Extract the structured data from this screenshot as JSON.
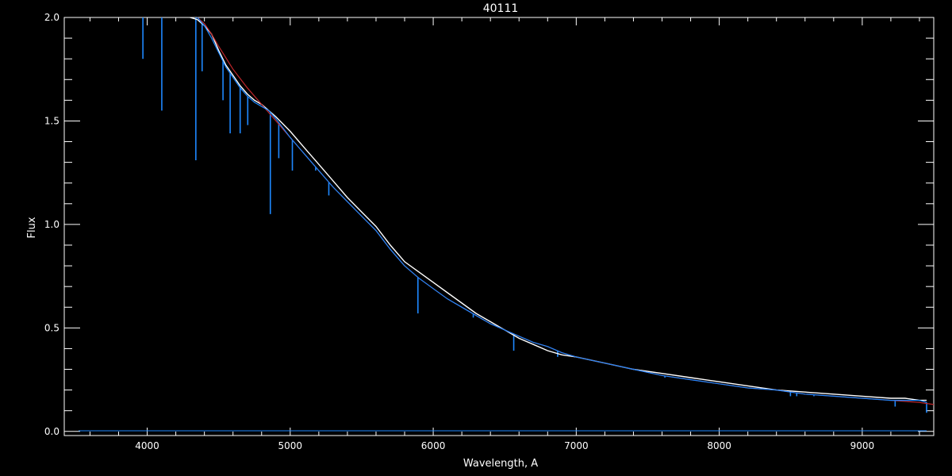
{
  "chart_data": {
    "type": "line",
    "title": "40111",
    "xlabel": "Wavelength, A",
    "ylabel": "Flux",
    "xlim": [
      3420,
      9500
    ],
    "ylim": [
      -0.02,
      2.0
    ],
    "x_ticks": [
      {
        "value": 4000,
        "label": "4000"
      },
      {
        "value": 5000,
        "label": "5000"
      },
      {
        "value": 6000,
        "label": "6000"
      },
      {
        "value": 7000,
        "label": "7000"
      },
      {
        "value": 8000,
        "label": "8000"
      },
      {
        "value": 9000,
        "label": "9000"
      }
    ],
    "y_ticks": [
      {
        "value": 0.0,
        "label": "0.0"
      },
      {
        "value": 0.5,
        "label": "0.5"
      },
      {
        "value": 1.0,
        "label": "1.0"
      },
      {
        "value": 1.5,
        "label": "1.5"
      },
      {
        "value": 2.0,
        "label": "2.0"
      }
    ],
    "grid": false,
    "legend": "none",
    "colors": {
      "background": "#000000",
      "axes": "#ffffff",
      "observed": "#ffffff",
      "model_smooth": "#c0262a",
      "model_detailed": "#1e88ff"
    },
    "series": [
      {
        "color": "#ffffff",
        "x": [
          4300,
          4350,
          4400,
          4450,
          4500,
          4550,
          4600,
          4650,
          4700,
          4750,
          4800,
          4850,
          4900,
          5000,
          5100,
          5200,
          5300,
          5400,
          5500,
          5600,
          5700,
          5800,
          5900,
          6000,
          6100,
          6200,
          6300,
          6400,
          6500,
          6600,
          6700,
          6800,
          6900,
          7000,
          7200,
          7400,
          7600,
          7800,
          8000,
          8200,
          8400,
          8600,
          8800,
          9000,
          9200,
          9300,
          9400,
          9450
        ],
        "y": [
          2.0,
          1.99,
          1.96,
          1.92,
          1.84,
          1.77,
          1.72,
          1.67,
          1.63,
          1.6,
          1.58,
          1.55,
          1.52,
          1.45,
          1.37,
          1.29,
          1.21,
          1.13,
          1.06,
          0.99,
          0.9,
          0.82,
          0.77,
          0.72,
          0.67,
          0.62,
          0.57,
          0.53,
          0.49,
          0.45,
          0.42,
          0.39,
          0.37,
          0.36,
          0.33,
          0.3,
          0.28,
          0.26,
          0.24,
          0.22,
          0.2,
          0.19,
          0.18,
          0.17,
          0.16,
          0.16,
          0.15,
          0.15
        ]
      },
      {
        "color": "#c0262a",
        "x": [
          4350,
          4400,
          4450,
          4500,
          4600,
          4700,
          4800,
          4900,
          5000,
          5100,
          5200,
          5300,
          5400,
          5500,
          5600,
          5700,
          5800,
          5900,
          6000,
          6100,
          6200,
          6300,
          6400,
          6500,
          6600,
          6700,
          6800,
          6900,
          7000,
          7200,
          7400,
          7600,
          7800,
          8000,
          8200,
          8400,
          8600,
          8800,
          9000,
          9200,
          9400,
          9500
        ],
        "y": [
          2.0,
          1.97,
          1.92,
          1.86,
          1.75,
          1.66,
          1.58,
          1.5,
          1.42,
          1.34,
          1.26,
          1.18,
          1.11,
          1.04,
          0.97,
          0.88,
          0.8,
          0.74,
          0.69,
          0.64,
          0.6,
          0.56,
          0.52,
          0.49,
          0.46,
          0.43,
          0.41,
          0.38,
          0.36,
          0.33,
          0.3,
          0.27,
          0.25,
          0.23,
          0.21,
          0.2,
          0.18,
          0.17,
          0.16,
          0.15,
          0.14,
          0.13
        ]
      },
      {
        "color": "#1e88ff",
        "x": [
          4350,
          4400,
          4450,
          4500,
          4550,
          4600,
          4650,
          4700,
          4750,
          4800,
          4850,
          4900,
          5000,
          5100,
          5200,
          5300,
          5400,
          5500,
          5600,
          5700,
          5800,
          5900,
          6000,
          6100,
          6200,
          6300,
          6400,
          6500,
          6600,
          6700,
          6800,
          6900,
          7000,
          7200,
          7400,
          7600,
          7800,
          8000,
          8200,
          8400,
          8600,
          8800,
          9000,
          9200,
          9300,
          9400,
          9450
        ],
        "y": [
          2.0,
          1.96,
          1.9,
          1.83,
          1.76,
          1.71,
          1.66,
          1.62,
          1.59,
          1.57,
          1.55,
          1.51,
          1.42,
          1.34,
          1.26,
          1.18,
          1.11,
          1.04,
          0.97,
          0.88,
          0.8,
          0.74,
          0.69,
          0.64,
          0.6,
          0.56,
          0.52,
          0.49,
          0.46,
          0.43,
          0.41,
          0.38,
          0.36,
          0.33,
          0.3,
          0.27,
          0.25,
          0.23,
          0.21,
          0.2,
          0.18,
          0.17,
          0.16,
          0.15,
          0.15,
          0.15,
          0.14
        ]
      }
    ],
    "absorption_features": [
      {
        "x": 3970,
        "y": 1.8
      },
      {
        "x": 4102,
        "y": 1.55
      },
      {
        "x": 4340,
        "y": 1.31
      },
      {
        "x": 4384,
        "y": 1.74
      },
      {
        "x": 4530,
        "y": 1.6
      },
      {
        "x": 4580,
        "y": 1.44
      },
      {
        "x": 4650,
        "y": 1.44
      },
      {
        "x": 4703,
        "y": 1.48
      },
      {
        "x": 4861,
        "y": 1.05
      },
      {
        "x": 4920,
        "y": 1.32
      },
      {
        "x": 5015,
        "y": 1.26
      },
      {
        "x": 5178,
        "y": 1.26
      },
      {
        "x": 5270,
        "y": 1.14
      },
      {
        "x": 5893,
        "y": 0.57
      },
      {
        "x": 6280,
        "y": 0.55
      },
      {
        "x": 6563,
        "y": 0.39
      },
      {
        "x": 6870,
        "y": 0.36
      },
      {
        "x": 7620,
        "y": 0.26
      },
      {
        "x": 8498,
        "y": 0.17
      },
      {
        "x": 8542,
        "y": 0.17
      },
      {
        "x": 8662,
        "y": 0.17
      },
      {
        "x": 9230,
        "y": 0.12
      },
      {
        "x": 9450,
        "y": 0.09
      }
    ]
  }
}
